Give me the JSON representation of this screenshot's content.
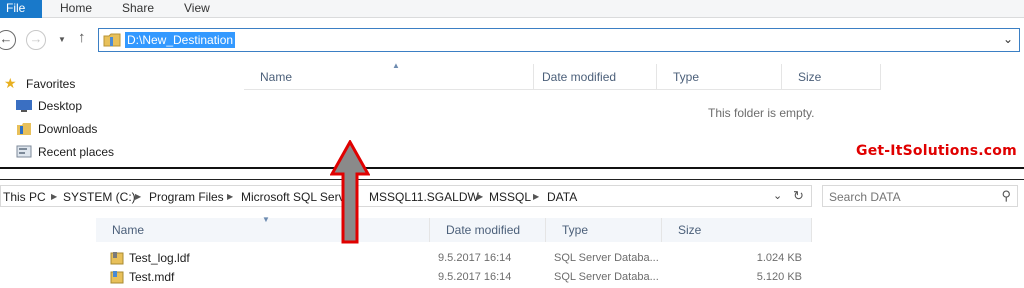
{
  "top_window": {
    "ribbon": {
      "file_tab": "File",
      "tabs": [
        "Home",
        "Share",
        "View"
      ]
    },
    "address_bar": {
      "path": "D:\\New_Destination"
    },
    "nav_pane": {
      "favorites_label": "Favorites",
      "items": [
        "Desktop",
        "Downloads",
        "Recent places"
      ]
    },
    "columns": [
      "Name",
      "Date modified",
      "Type",
      "Size"
    ],
    "empty_message": "This folder is empty."
  },
  "watermark": "Get-ItSolutions.com",
  "bottom_window": {
    "breadcrumb": [
      "This PC",
      "SYSTEM (C:)",
      "Program Files",
      "Microsoft SQL Serv",
      "MSSQL11.SGALDW",
      "MSSQL",
      "DATA"
    ],
    "search_placeholder": "Search DATA",
    "columns": [
      "Name",
      "Date modified",
      "Type",
      "Size"
    ],
    "files": [
      {
        "name": "Test_log.ldf",
        "date": "9.5.2017 16:14",
        "type": "SQL Server Databa...",
        "size": "1.024 KB"
      },
      {
        "name": "Test.mdf",
        "date": "9.5.2017 16:14",
        "type": "SQL Server Databa...",
        "size": "5.120 KB"
      }
    ]
  },
  "colors": {
    "file_tab": "#1979ca",
    "selection": "#3399ff",
    "arrow_fill": "#8a8a8a",
    "arrow_outline": "#e00000",
    "watermark": "#e00000"
  },
  "icons": {
    "back": "back-arrow-icon",
    "forward": "forward-arrow-icon",
    "up": "up-arrow-icon",
    "folder": "folder-icon",
    "favorites": "star-icon",
    "desktop": "desktop-icon",
    "downloads": "downloads-icon",
    "recent": "recent-places-icon",
    "refresh": "refresh-icon",
    "search": "search-icon",
    "file": "database-file-icon"
  }
}
